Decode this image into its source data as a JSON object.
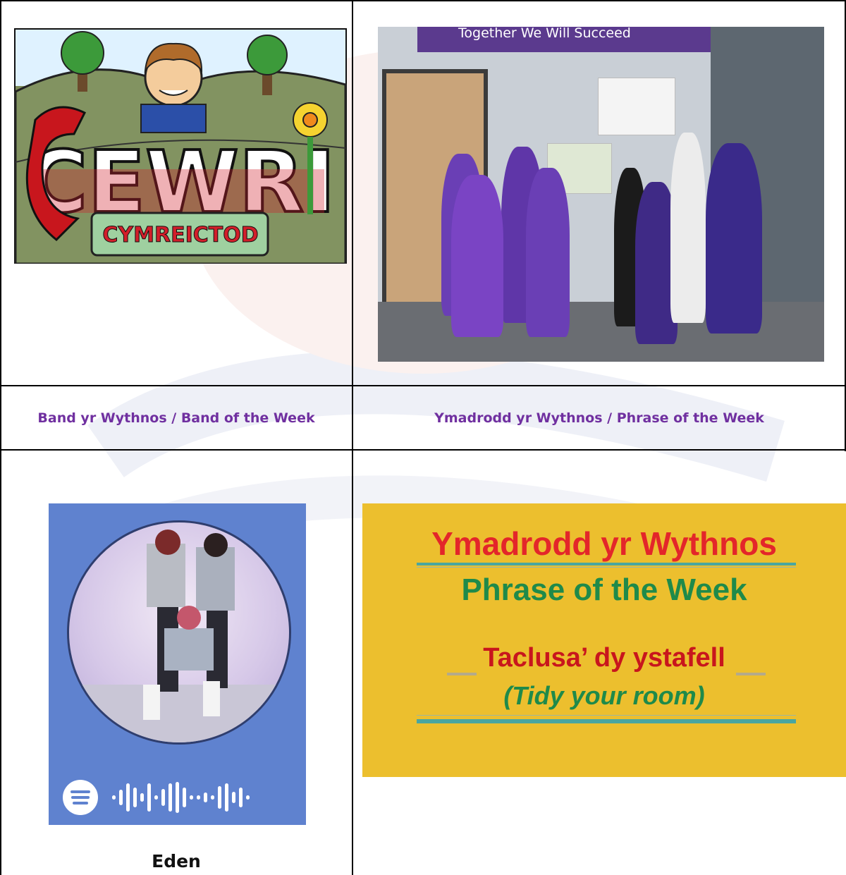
{
  "headers": {
    "band": "Band yr Wythnos / Band of the Week",
    "phrase": "Ymadrodd yr Wythnos / Phrase of the Week"
  },
  "logo": {
    "text": "CEWRI",
    "subtitle": "CYMREICTOD"
  },
  "photo": {
    "banner": "Together We Will Succeed"
  },
  "band": {
    "name": "Eden"
  },
  "phrase_card": {
    "title_cy": "Ymadrodd yr Wythnos",
    "title_en": "Phrase of the Week",
    "phrase_cy": "Taclusa’ dy ystafell",
    "phrase_en": "(Tidy your room)"
  },
  "colors": {
    "header_purple": "#7030a0",
    "card_yellow": "#ecbf2e",
    "card_red": "#e3262a",
    "card_green": "#1f8a4a",
    "spotify_blue": "#5f82cf"
  }
}
